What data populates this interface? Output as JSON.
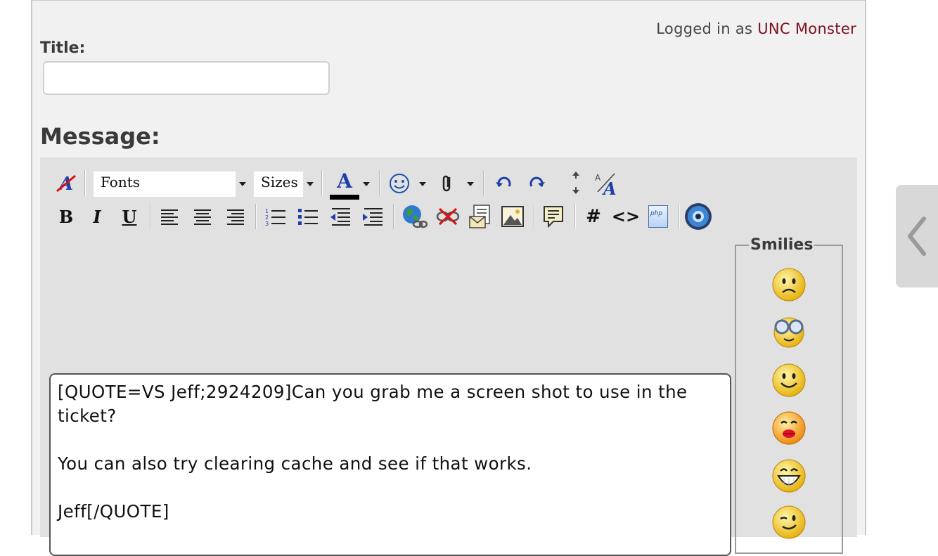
{
  "header": {
    "logged_in_prefix": "Logged in as ",
    "username": "UNC Monster"
  },
  "form": {
    "title_label": "Title:",
    "title_value": "",
    "message_label": "Message:"
  },
  "toolbar": {
    "font_select": "Fonts",
    "size_select": "Sizes",
    "bold": "B",
    "italic": "I",
    "underline": "U",
    "text_color_glyph": "A",
    "hash": "#",
    "code": "<>",
    "php": "php"
  },
  "message": {
    "text": "[QUOTE=VS Jeff;2924209]Can you grab me a screen shot to use in the ticket?\n\nYou can also try clearing cache and see if that works.\n\nJeff[/QUOTE]"
  },
  "smilies": {
    "legend": "Smilies",
    "items": [
      "frown",
      "geek",
      "smile",
      "kiss",
      "grin",
      "wink"
    ]
  },
  "colors": {
    "username": "#7a0f1f",
    "panel_bg": "#f1f1f1",
    "editor_bg": "#e1e1e1"
  }
}
